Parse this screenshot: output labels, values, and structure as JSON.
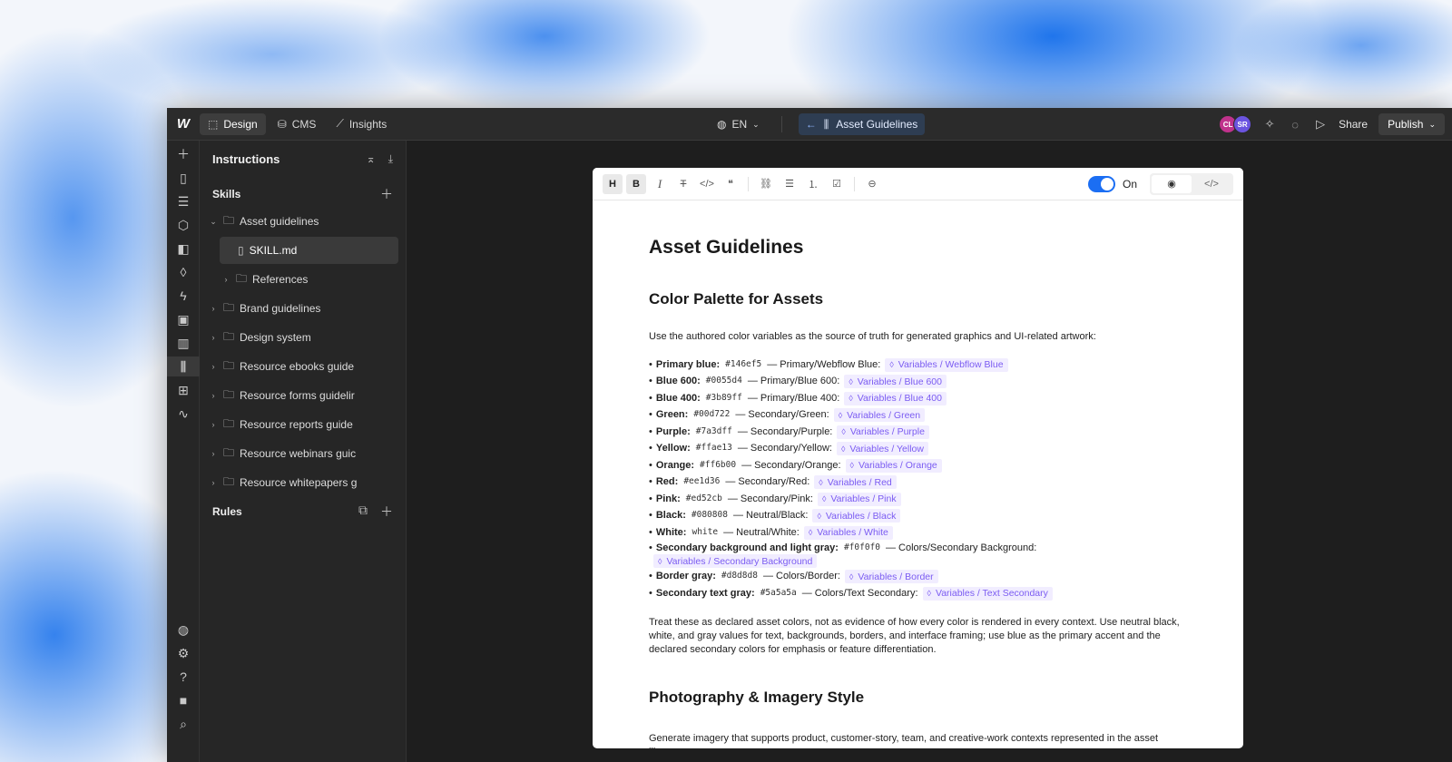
{
  "topbar": {
    "logo": "W",
    "tabs": [
      {
        "label": "Design",
        "icon": "cursor-box-icon"
      },
      {
        "label": "CMS",
        "icon": "database-icon"
      },
      {
        "label": "Insights",
        "icon": "chart-line-icon"
      }
    ],
    "language": "EN",
    "page_name": "Asset Guidelines",
    "avatars": [
      "CL",
      "SR"
    ],
    "share_label": "Share",
    "publish_label": "Publish"
  },
  "panel": {
    "title": "Instructions",
    "skills_label": "Skills",
    "rules_label": "Rules",
    "tree": [
      {
        "label": "Asset guidelines",
        "type": "folder",
        "expanded": true,
        "level": 0
      },
      {
        "label": "SKILL.md",
        "type": "file",
        "level": 2,
        "selected": true
      },
      {
        "label": "References",
        "type": "folder",
        "expanded": false,
        "level": 1
      },
      {
        "label": "Brand guidelines",
        "type": "folder",
        "level": 0
      },
      {
        "label": "Design system",
        "type": "folder",
        "level": 0
      },
      {
        "label": "Resource ebooks guide",
        "type": "folder",
        "level": 0
      },
      {
        "label": "Resource forms guidelir",
        "type": "folder",
        "level": 0
      },
      {
        "label": "Resource reports guide",
        "type": "folder",
        "level": 0
      },
      {
        "label": "Resource webinars guic",
        "type": "folder",
        "level": 0
      },
      {
        "label": "Resource whitepapers g",
        "type": "folder",
        "level": 0
      }
    ]
  },
  "editor": {
    "toggle_label": "On",
    "h1": "Asset Guidelines",
    "section1_title": "Color Palette for Assets",
    "intro": "Use the authored color variables as the source of truth for generated graphics and UI-related artwork:",
    "colors": [
      {
        "name": "Primary blue:",
        "hex": "#146ef5",
        "role": "— Primary/Webflow Blue:",
        "var": "Variables / Webflow Blue"
      },
      {
        "name": "Blue 600:",
        "hex": "#0055d4",
        "role": "— Primary/Blue 600:",
        "var": "Variables / Blue 600"
      },
      {
        "name": "Blue 400:",
        "hex": "#3b89ff",
        "role": "— Primary/Blue 400:",
        "var": "Variables / Blue 400"
      },
      {
        "name": "Green:",
        "hex": "#00d722",
        "role": "— Secondary/Green:",
        "var": "Variables / Green"
      },
      {
        "name": "Purple:",
        "hex": "#7a3dff",
        "role": "— Secondary/Purple:",
        "var": "Variables / Purple"
      },
      {
        "name": "Yellow:",
        "hex": "#ffae13",
        "role": "— Secondary/Yellow:",
        "var": "Variables / Yellow"
      },
      {
        "name": "Orange:",
        "hex": "#ff6b00",
        "role": "— Secondary/Orange:",
        "var": "Variables / Orange"
      },
      {
        "name": "Red:",
        "hex": "#ee1d36",
        "role": "— Secondary/Red:",
        "var": "Variables / Red"
      },
      {
        "name": "Pink:",
        "hex": "#ed52cb",
        "role": "— Secondary/Pink:",
        "var": "Variables / Pink"
      },
      {
        "name": "Black:",
        "hex": "#080808",
        "role": "— Neutral/Black:",
        "var": "Variables / Black"
      },
      {
        "name": "White:",
        "hex": "white",
        "role": "— Neutral/White:",
        "var": "Variables / White"
      },
      {
        "name": "Secondary background and light gray:",
        "hex": "#f0f0f0",
        "role": "— Colors/Secondary Background:",
        "var": "Variables / Secondary Background"
      },
      {
        "name": "Border gray:",
        "hex": "#d8d8d8",
        "role": "— Colors/Border:",
        "var": "Variables / Border"
      },
      {
        "name": "Secondary text gray:",
        "hex": "#5a5a5a",
        "role": "— Colors/Text Secondary:",
        "var": "Variables / Text Secondary"
      }
    ],
    "paragraph2": "Treat these as declared asset colors, not as evidence of how every color is rendered in every context. Use neutral black, white, and gray values for text, backgrounds, borders, and interface framing; use blue as the primary accent and the declared secondary colors for emphasis or feature differentiation.",
    "section2_title": "Photography & Imagery Style",
    "paragraph3": "Generate imagery that supports product, customer-story, team, and creative-work contexts represented in the asset library."
  },
  "colors": {
    "accent": "#146ef5",
    "chip_bg": "#f1edff",
    "chip_text": "#7b5cf2",
    "app_bg": "#1e1e1e"
  }
}
